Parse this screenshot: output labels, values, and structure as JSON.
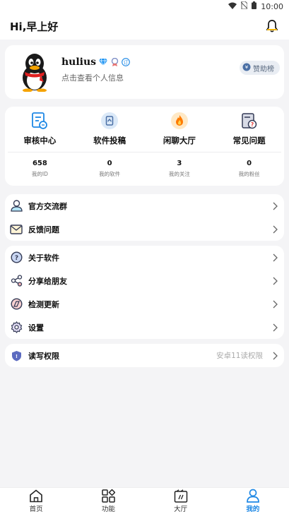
{
  "status_bar": {
    "time": "10:00"
  },
  "header": {
    "greeting": "Hi,早上好"
  },
  "profile": {
    "username": "hulius",
    "subtitle": "点击查看个人信息",
    "sponsor_label": "赞助榜"
  },
  "features": [
    {
      "label": "审核中心",
      "icon": "review-icon"
    },
    {
      "label": "软件投稿",
      "icon": "submit-software-icon"
    },
    {
      "label": "闲聊大厅",
      "icon": "chat-hall-icon"
    },
    {
      "label": "常见问题",
      "icon": "faq-icon"
    }
  ],
  "stats": [
    {
      "value": "658",
      "label": "我的ID"
    },
    {
      "value": "0",
      "label": "我的软件"
    },
    {
      "value": "3",
      "label": "我的关注"
    },
    {
      "value": "0",
      "label": "我的粉丝"
    }
  ],
  "menu_group_1": [
    {
      "label": "官方交流群",
      "icon": "group-icon"
    },
    {
      "label": "反馈问题",
      "icon": "mail-icon"
    }
  ],
  "menu_group_2": [
    {
      "label": "关于软件",
      "icon": "about-icon"
    },
    {
      "label": "分享给朋友",
      "icon": "share-icon"
    },
    {
      "label": "检测更新",
      "icon": "update-icon"
    },
    {
      "label": "设置",
      "icon": "settings-icon"
    }
  ],
  "menu_group_3": [
    {
      "label": "读写权限",
      "value": "安卓11读权限",
      "icon": "shield-icon"
    }
  ],
  "tabs": [
    {
      "label": "首页",
      "icon": "home-icon"
    },
    {
      "label": "功能",
      "icon": "apps-icon"
    },
    {
      "label": "大厅",
      "icon": "hall-icon"
    },
    {
      "label": "我的",
      "icon": "person-icon"
    }
  ],
  "colors": {
    "accent": "#1e88e5",
    "background": "#f4f4f6",
    "card": "#ffffff"
  }
}
